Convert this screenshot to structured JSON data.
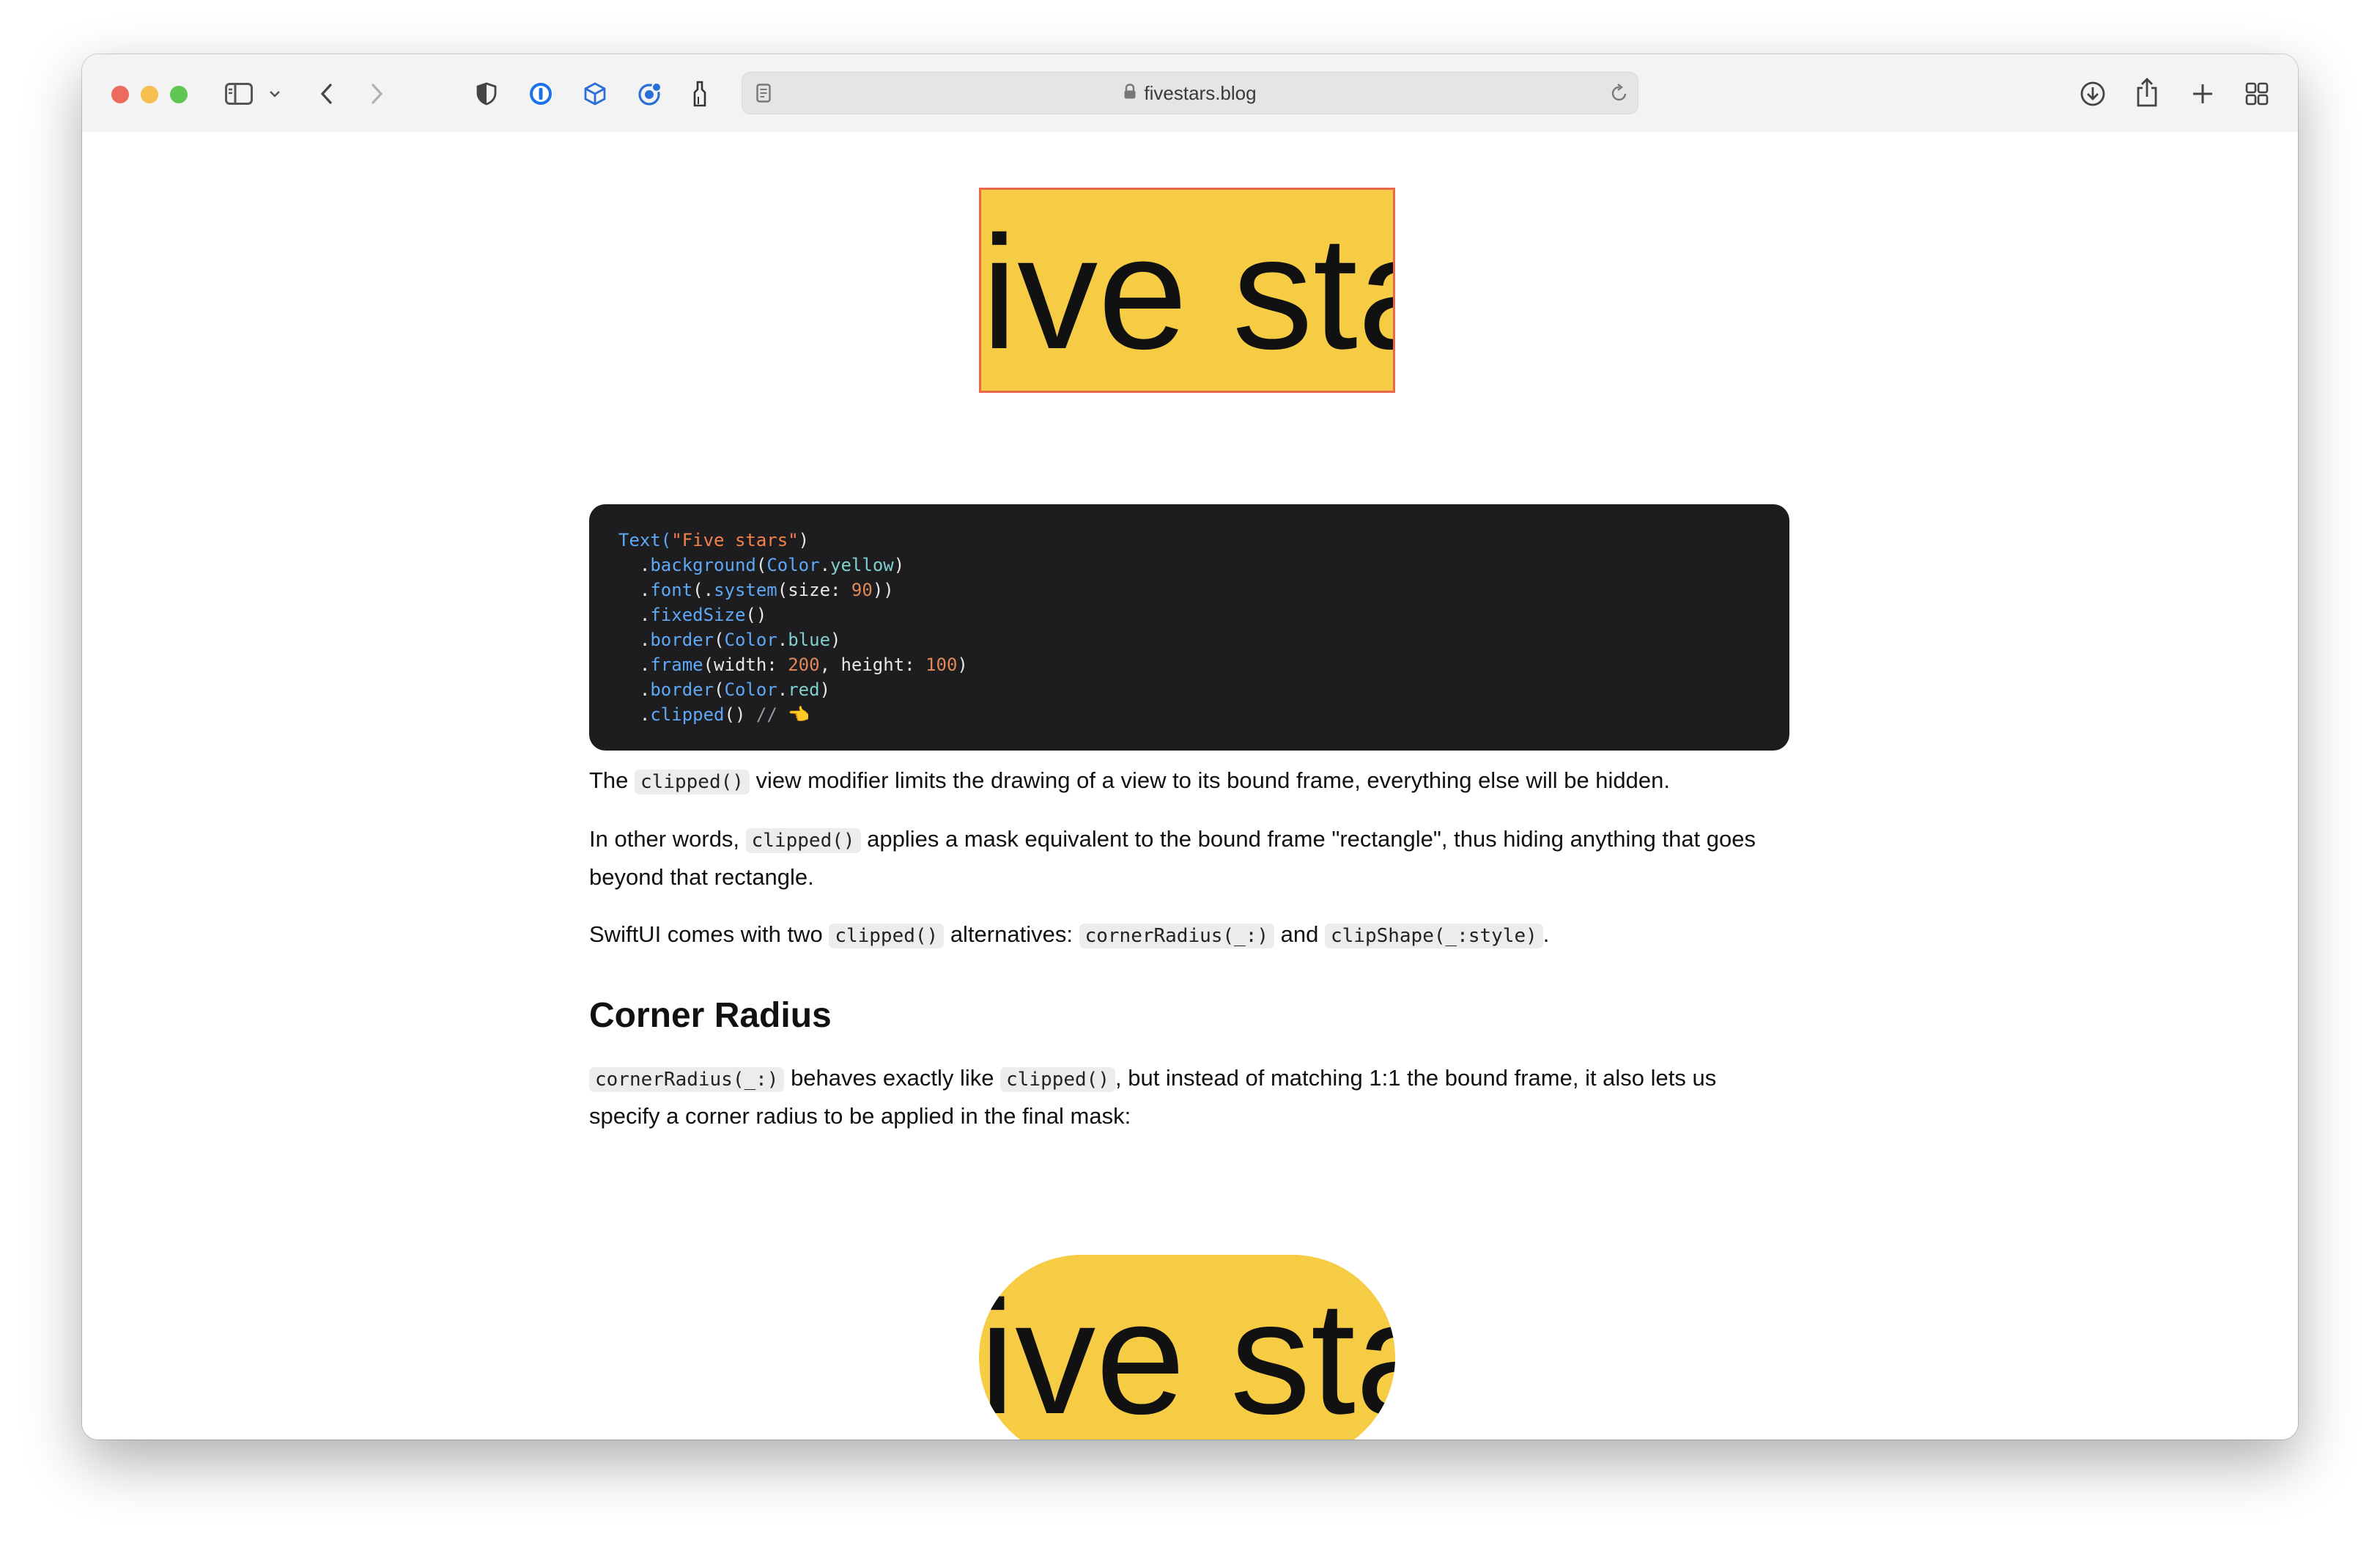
{
  "browser": {
    "url": "fivestars.blog",
    "colors": {
      "close": "#ed6a5e",
      "minimize": "#f5bf4f",
      "maximize": "#61c554"
    },
    "icons": [
      "sidebar-icon",
      "chevron-down-icon",
      "back-icon",
      "forward-icon",
      "privacy-shield-icon",
      "password-manager-icon",
      "box-extension-icon",
      "refresh-badge-extension-icon",
      "sweep-extension-icon",
      "reader-icon",
      "lock-icon",
      "reload-icon",
      "download-icon",
      "share-icon",
      "new-tab-icon",
      "tab-overview-icon"
    ]
  },
  "article": {
    "demo_text": "Five stars",
    "code_lines": [
      [
        {
          "t": "Text(",
          "c": "c-fn"
        },
        {
          "t": "\"Five stars\"",
          "c": "c-str"
        },
        {
          "t": ")",
          "c": ""
        }
      ],
      [
        {
          "t": "  .",
          "c": ""
        },
        {
          "t": "background",
          "c": "c-fn"
        },
        {
          "t": "(",
          "c": ""
        },
        {
          "t": "Color",
          "c": "c-fn"
        },
        {
          "t": ".",
          "c": ""
        },
        {
          "t": "yellow",
          "c": "c-type"
        },
        {
          "t": ")",
          "c": ""
        }
      ],
      [
        {
          "t": "  .",
          "c": ""
        },
        {
          "t": "font",
          "c": "c-fn"
        },
        {
          "t": "(.",
          "c": ""
        },
        {
          "t": "system",
          "c": "c-fn"
        },
        {
          "t": "(size: ",
          "c": ""
        },
        {
          "t": "90",
          "c": "c-num"
        },
        {
          "t": "))",
          "c": ""
        }
      ],
      [
        {
          "t": "  .",
          "c": ""
        },
        {
          "t": "fixedSize",
          "c": "c-fn"
        },
        {
          "t": "()",
          "c": ""
        }
      ],
      [
        {
          "t": "  .",
          "c": ""
        },
        {
          "t": "border",
          "c": "c-fn"
        },
        {
          "t": "(",
          "c": ""
        },
        {
          "t": "Color",
          "c": "c-fn"
        },
        {
          "t": ".",
          "c": ""
        },
        {
          "t": "blue",
          "c": "c-type"
        },
        {
          "t": ")",
          "c": ""
        }
      ],
      [
        {
          "t": "  .",
          "c": ""
        },
        {
          "t": "frame",
          "c": "c-fn"
        },
        {
          "t": "(width: ",
          "c": ""
        },
        {
          "t": "200",
          "c": "c-num"
        },
        {
          "t": ", height: ",
          "c": ""
        },
        {
          "t": "100",
          "c": "c-num"
        },
        {
          "t": ")",
          "c": ""
        }
      ],
      [
        {
          "t": "  .",
          "c": ""
        },
        {
          "t": "border",
          "c": "c-fn"
        },
        {
          "t": "(",
          "c": ""
        },
        {
          "t": "Color",
          "c": "c-fn"
        },
        {
          "t": ".",
          "c": ""
        },
        {
          "t": "red",
          "c": "c-type"
        },
        {
          "t": ")",
          "c": ""
        }
      ],
      [
        {
          "t": "  .",
          "c": ""
        },
        {
          "t": "clipped",
          "c": "c-fn"
        },
        {
          "t": "() ",
          "c": ""
        },
        {
          "t": "// 👈",
          "c": "c-cm"
        }
      ]
    ],
    "paragraphs": [
      [
        {
          "text": "The "
        },
        {
          "code": "clipped()"
        },
        {
          "text": " view modifier limits the drawing of a view to its bound frame, everything else will be hidden."
        }
      ],
      [
        {
          "text": "In other words, "
        },
        {
          "code": "clipped()"
        },
        {
          "text": " applies a mask equivalent to the bound frame \"rectangle\", thus hiding anything that goes beyond that rectangle."
        }
      ],
      [
        {
          "text": "SwiftUI comes with two "
        },
        {
          "code": "clipped()"
        },
        {
          "text": " alternatives: "
        },
        {
          "code": "cornerRadius(_:)"
        },
        {
          "text": " and "
        },
        {
          "code": "clipShape(_:style)"
        },
        {
          "text": "."
        }
      ],
      [
        {
          "code": "cornerRadius(_:)"
        },
        {
          "text": " behaves exactly like "
        },
        {
          "code": "clipped()"
        },
        {
          "text": ", but instead of matching 1:1 the bound frame, it also lets us specify a corner radius to be applied in the final mask:"
        }
      ]
    ],
    "heading": "Corner Radius"
  }
}
